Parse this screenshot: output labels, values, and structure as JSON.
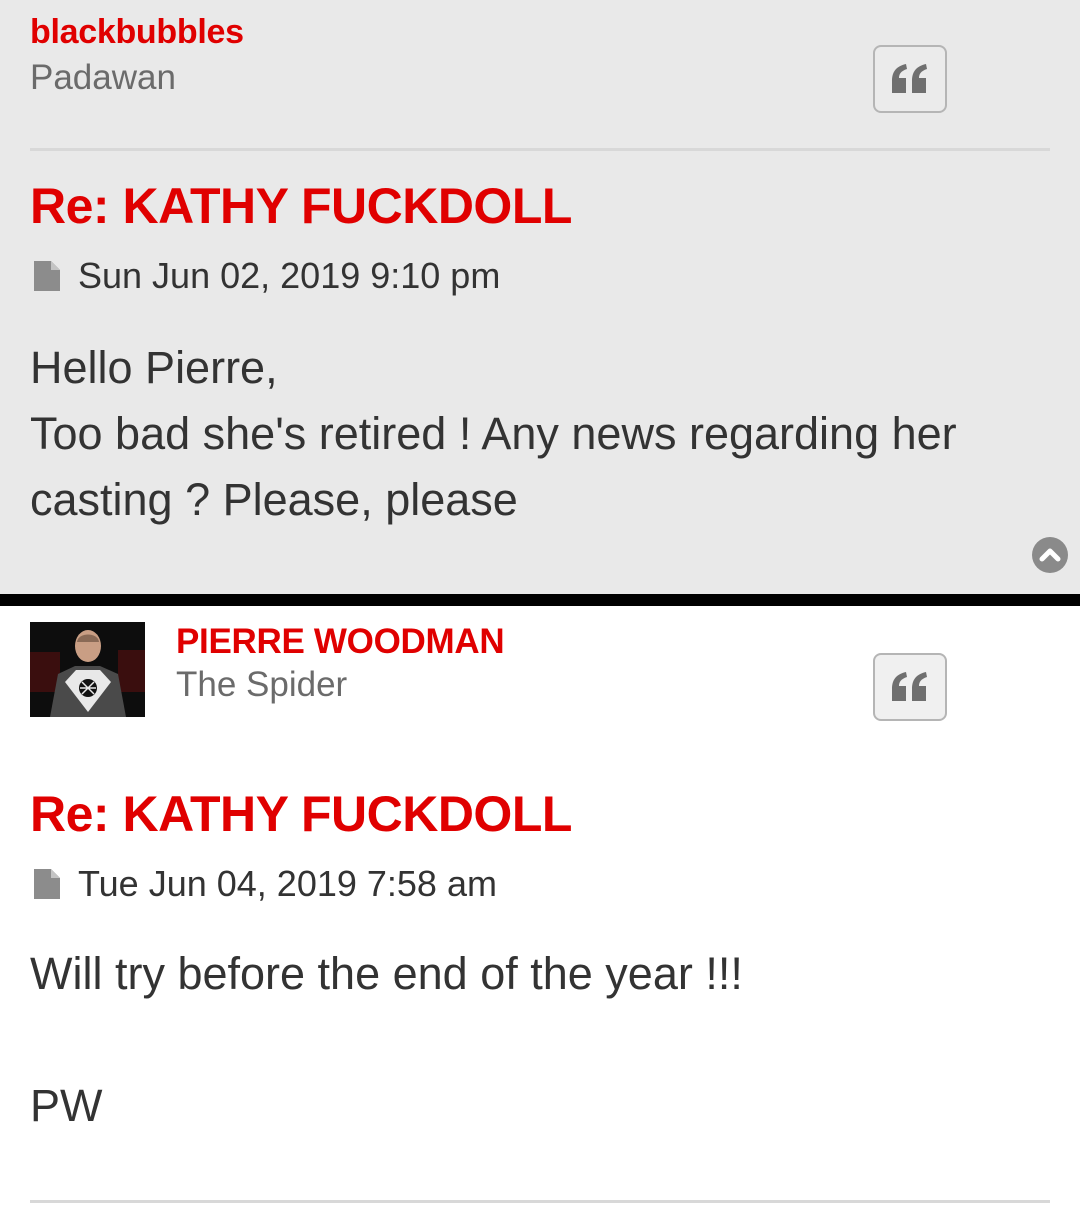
{
  "posts": [
    {
      "author": "blackbubbles",
      "rank": "Padawan",
      "title": "Re: KATHY FUCKDOLL",
      "date": "Sun Jun 02, 2019 9:10 pm",
      "body_lines": [
        "Hello Pierre,",
        "Too bad she's retired ! Any news regarding her casting ? Please, please"
      ]
    },
    {
      "author": "PIERRE WOODMAN",
      "rank": "The Spider",
      "title": "Re: KATHY FUCKDOLL",
      "date": "Tue Jun 04, 2019 7:58 am",
      "body_lines": [
        "Will try before the end of the year !!!",
        "",
        "PW"
      ]
    }
  ],
  "icons": {
    "quote": "quote-icon",
    "post": "file-icon",
    "back_to_top": "chevron-up-icon"
  },
  "colors": {
    "accent_red": "#e00000",
    "post_bg_odd": "#e9e9e9",
    "post_bg_even": "#ffffff",
    "text": "#333333",
    "muted": "#6b6b6b"
  }
}
